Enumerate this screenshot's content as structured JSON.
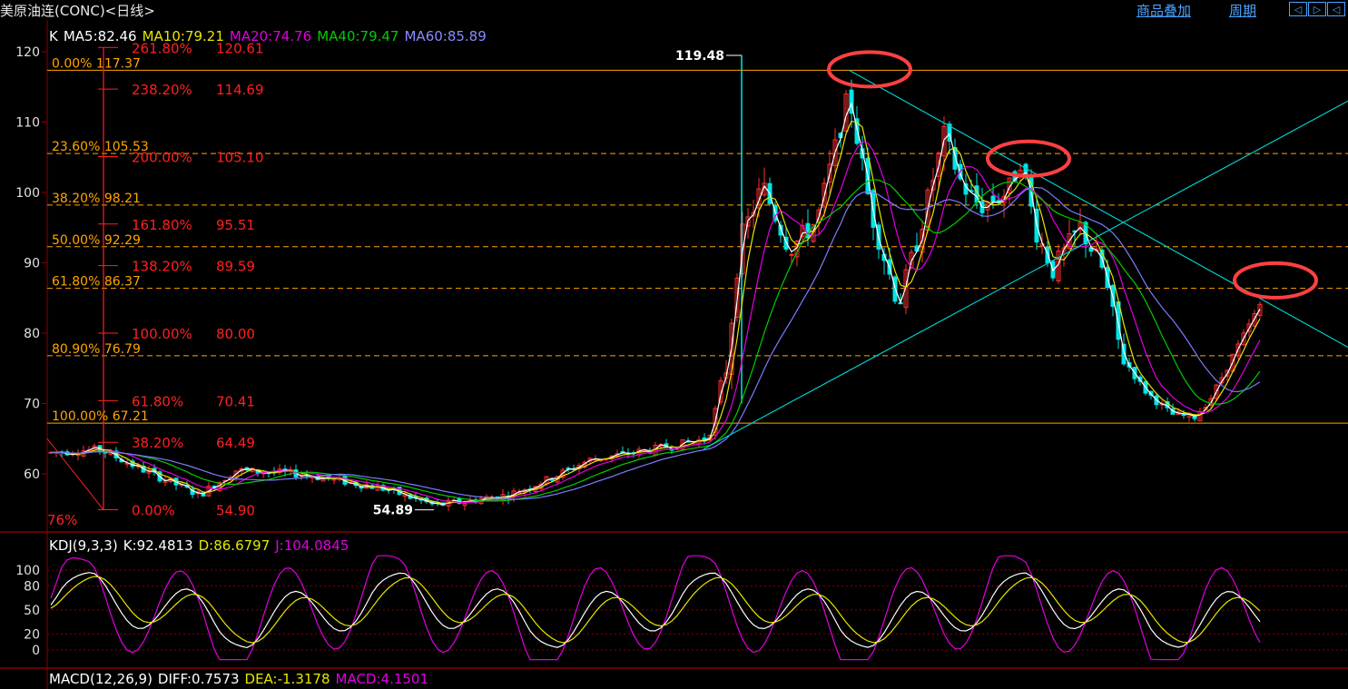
{
  "header": {
    "title": "美原油连(CONC)<日线>",
    "links": {
      "overlay": "商品叠加",
      "period": "周期"
    },
    "nav": [
      "◁",
      "▷",
      "◁"
    ]
  },
  "price_panel": {
    "legend": {
      "k": "K",
      "ma5": "MA5:82.46",
      "ma10": "MA10:79.21",
      "ma20": "MA20:74.76",
      "ma40": "MA40:79.47",
      "ma60": "MA60:85.89"
    },
    "y_ticks": [
      "120",
      "110",
      "100",
      "90",
      "80",
      "70",
      "60"
    ],
    "fib_left": [
      {
        "label": "0.00% 117.37",
        "value": 117.37
      },
      {
        "label": "23.60% 105.53",
        "value": 105.53
      },
      {
        "label": "38.20% 98.21",
        "value": 98.21
      },
      {
        "label": "50.00% 92.29",
        "value": 92.29
      },
      {
        "label": "61.80% 86.37",
        "value": 86.37
      },
      {
        "label": "80.90% 76.79",
        "value": 76.79
      },
      {
        "label": "100.00% 67.21",
        "value": 67.21
      }
    ],
    "fib_ext": [
      {
        "pct": "261.80%",
        "val": "120.61",
        "value": 120.61
      },
      {
        "pct": "238.20%",
        "val": "114.69",
        "value": 114.69
      },
      {
        "pct": "200.00%",
        "val": "105.10",
        "value": 105.1
      },
      {
        "pct": "161.80%",
        "val": "95.51",
        "value": 95.51
      },
      {
        "pct": "138.20%",
        "val": "89.59",
        "value": 89.59
      },
      {
        "pct": "100.00%",
        "val": "80.00",
        "value": 80.0
      },
      {
        "pct": "61.80%",
        "val": "70.41",
        "value": 70.41
      },
      {
        "pct": "38.20%",
        "val": "64.49",
        "value": 64.49
      },
      {
        "pct": "0.00%",
        "val": "54.90",
        "value": 54.9
      }
    ],
    "left_edge_label": "76%",
    "high_label": "119.48",
    "low_label": "54.89",
    "colors": {
      "ma5": "#ffffff",
      "ma10": "#e6e600",
      "ma20": "#e000e0",
      "ma40": "#00cc00",
      "ma60": "#7b7bff",
      "up": "#ff3030",
      "down": "#00e5e5",
      "fib": "#ffa500",
      "ext": "#ff2020",
      "trend": "#00cccc",
      "circle": "#ff4040"
    }
  },
  "kdj_panel": {
    "legend": {
      "name": "KDJ(9,3,3)",
      "k": "K:92.4813",
      "d": "D:86.6797",
      "j": "J:104.0845"
    },
    "y_ticks": [
      "100",
      "80",
      "50",
      "20",
      "0"
    ]
  },
  "macd_panel": {
    "legend": {
      "name": "MACD(12,26,9)",
      "diff": "DIFF:0.7573",
      "dea": "DEA:-1.3178",
      "macd": "MACD:4.1501"
    }
  }
}
